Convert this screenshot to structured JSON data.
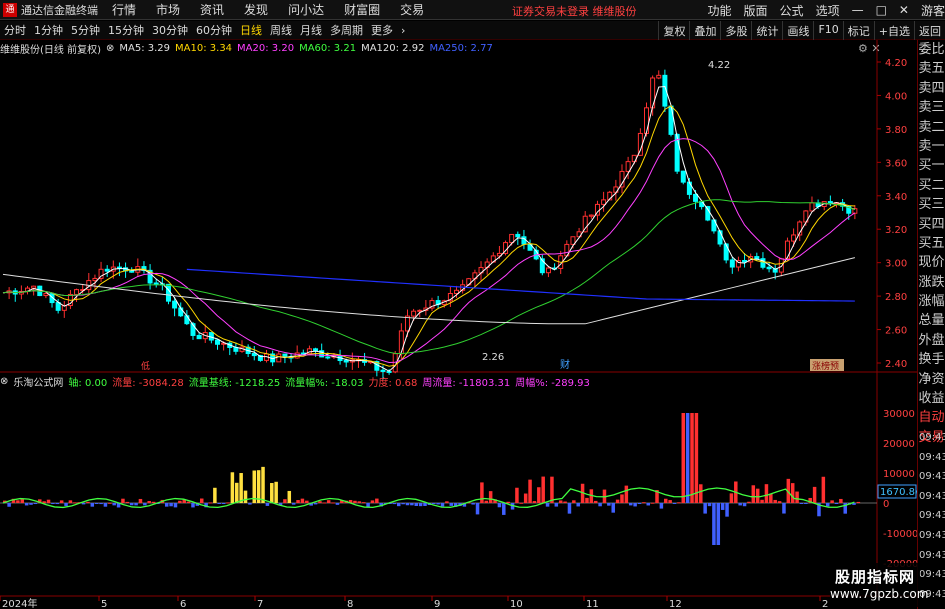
{
  "app": {
    "name": "通达信金融终端",
    "logo_glyph": "通"
  },
  "menu": [
    "行情",
    "市场",
    "资讯",
    "发现",
    "问小达",
    "财富圈",
    "交易"
  ],
  "warning": "证券交易未登录",
  "stock_name_top": "维维股份",
  "right_menu": [
    "功能",
    "版面",
    "公式",
    "选项",
    "画线",
    "游客"
  ],
  "window_controls": [
    "—",
    "□",
    "✕"
  ],
  "toolbar": {
    "periods": [
      "分时",
      "1分钟",
      "5分钟",
      "15分钟",
      "30分钟",
      "60分钟",
      "日线",
      "周线",
      "月线",
      "多周期",
      "更多"
    ],
    "active": "日线",
    "right": [
      "复权",
      "叠加",
      "多股",
      "统计",
      "画线",
      "F10",
      "标记",
      "+自选",
      "返回"
    ]
  },
  "ma": {
    "title": "维维股份(日线 前复权)",
    "items": [
      {
        "label": "MA5: 3.29",
        "color": "#e0e0e0"
      },
      {
        "label": "MA10: 3.34",
        "color": "#ffd700"
      },
      {
        "label": "MA20: 3.20",
        "color": "#ff40ff"
      },
      {
        "label": "MA60: 3.21",
        "color": "#40ff40"
      },
      {
        "label": "MA120: 2.92",
        "color": "#e0e0e0"
      },
      {
        "label": "MA250: 2.77",
        "color": "#4040ff"
      }
    ]
  },
  "flow": {
    "title": "乐淘公式网",
    "items": [
      {
        "label": "轴: 0.00",
        "color": "#40ff40"
      },
      {
        "label": "流量: -3084.28",
        "color": "#ff4040"
      },
      {
        "label": "流量基线: -1218.25",
        "color": "#40ff40"
      },
      {
        "label": "流量幅%: -18.03",
        "color": "#40ff40"
      },
      {
        "label": "力度: 0.68",
        "color": "#ff4040"
      },
      {
        "label": "周流量: -11803.31",
        "color": "#ff40ff"
      },
      {
        "label": "周幅%: -289.93",
        "color": "#ff40ff"
      }
    ]
  },
  "price_axis": [
    "4.20",
    "4.00",
    "3.80",
    "3.60",
    "3.40",
    "3.20",
    "3.00",
    "2.80",
    "2.60",
    "2.40"
  ],
  "flow_axis": [
    "30000",
    "20000",
    "10000",
    "0",
    "-10000",
    "-20000"
  ],
  "flow_readout": "1670.84",
  "annotations": {
    "high": "4.22",
    "low": "2.26",
    "cai": "财",
    "zhang": "涨榜预",
    "lower": "低"
  },
  "date_axis": [
    "2024年",
    "5",
    "6",
    "7",
    "8",
    "9",
    "10",
    "11",
    "12",
    "2"
  ],
  "side_labels": [
    "委比",
    "卖五",
    "卖四",
    "卖三",
    "卖二",
    "卖一",
    "买一",
    "买二",
    "买三",
    "买四",
    "买五",
    "现价",
    "涨跌",
    "涨幅",
    "总量",
    "外盘",
    "换手",
    "净资",
    "收益",
    "自动",
    "交易"
  ],
  "times": [
    "09:43",
    "09:43",
    "09:43",
    "09:43",
    "09:43",
    "09:43",
    "09:43",
    "09:43",
    "09:43"
  ],
  "watermark": {
    "line1": "股朋指标网",
    "line2": "www.7gpzb.com"
  },
  "colors": {
    "up": "#ff3030",
    "down": "#00ffff",
    "ma250": "#2030ff",
    "ma60": "#30d030",
    "ma120": "#e0e0e0",
    "ma20": "#ff40ff",
    "ma10": "#ffd700",
    "ma5": "#ffffff"
  }
}
